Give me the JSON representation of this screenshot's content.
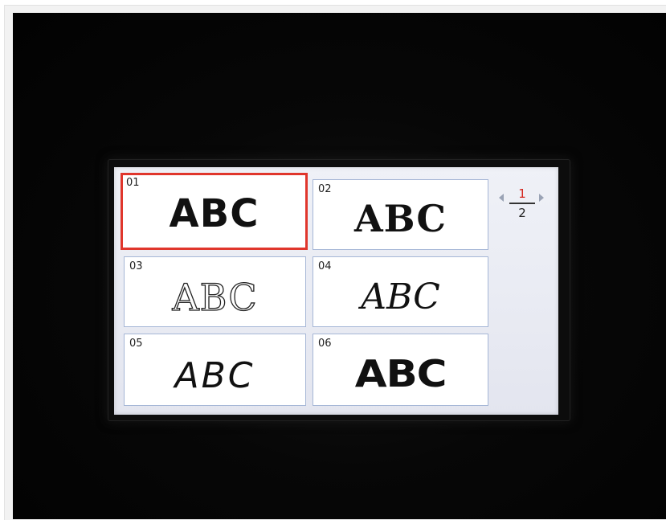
{
  "screen": {
    "font_tiles": [
      {
        "number": "01",
        "sample": "ABC",
        "selected": true
      },
      {
        "number": "02",
        "sample": "ABC",
        "selected": false
      },
      {
        "number": "03",
        "sample": "ABC",
        "selected": false
      },
      {
        "number": "04",
        "sample": "ABC",
        "selected": false
      },
      {
        "number": "05",
        "sample": "ABC",
        "selected": false
      },
      {
        "number": "06",
        "sample": "ABC",
        "selected": false
      }
    ],
    "page_indicator": {
      "current": "1",
      "total": "2"
    }
  },
  "colors": {
    "selection_border": "#e0362c",
    "tile_border": "#a5b6d6",
    "page_current": "#d4261e",
    "screen_background": "#eceef5",
    "surround": "#050505"
  },
  "icons": {
    "page_prev": "triangle-left-icon",
    "page_next": "triangle-right-icon"
  }
}
